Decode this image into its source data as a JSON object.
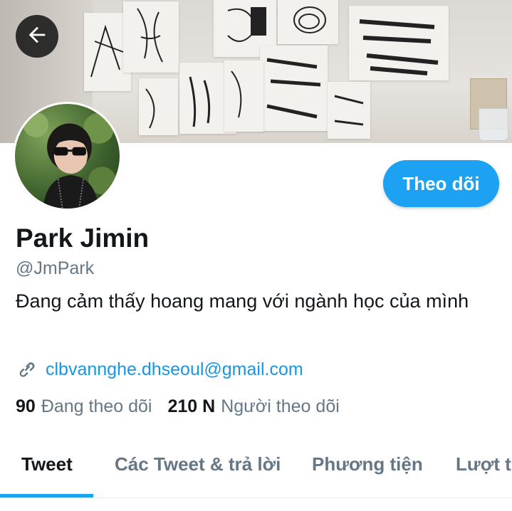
{
  "header": {
    "back_icon": "arrow-left-icon"
  },
  "profile": {
    "name": "Park Jimin",
    "handle": "@JmPark",
    "bio": "Đang cảm thấy hoang mang với ngành học của mình",
    "link": "clbvannghe.dhseoul@gmail.com",
    "link_icon": "link-icon",
    "follow_label": "Theo dõi"
  },
  "stats": {
    "following_count": "90",
    "following_label": "Đang theo dõi",
    "followers_count": "210 N",
    "followers_label": "Người theo dõi"
  },
  "tabs": [
    {
      "label": "Tweet",
      "active": true
    },
    {
      "label": "Các Tweet & trả lời",
      "active": false
    },
    {
      "label": "Phương tiện",
      "active": false
    },
    {
      "label": "Lượt thích",
      "active": false
    }
  ],
  "colors": {
    "accent": "#1da1f2",
    "link": "#1b95e0",
    "muted": "#657786",
    "text": "#14171a"
  }
}
